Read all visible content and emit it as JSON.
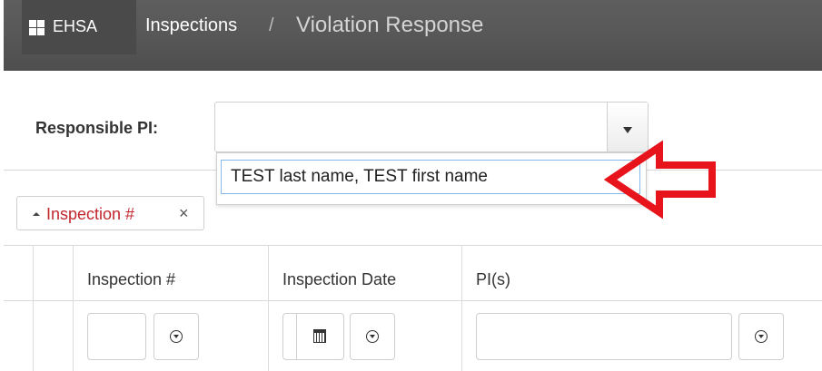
{
  "nav": {
    "brand": "EHSA",
    "breadcrumb_link": "Inspections",
    "breadcrumb_separator": "/",
    "breadcrumb_current": "Violation Response"
  },
  "responsible_pi": {
    "label": "Responsible PI:",
    "value": "",
    "dropdown_options": [
      "TEST last name, TEST first name"
    ]
  },
  "filter_chip": {
    "label": "Inspection #",
    "close": "×"
  },
  "grid": {
    "columns": [
      "Inspection #",
      "Inspection Date",
      "PI(s)"
    ]
  },
  "colors": {
    "navbar": "#585858",
    "chip_text": "#c1272d",
    "arrow": "#e8141b",
    "highlight_border": "#86b8e8"
  },
  "icons": [
    "grid-icon",
    "caret-down-icon",
    "red-arrow-icon",
    "caret-up-icon",
    "close-icon",
    "calendar-icon",
    "filter-icon"
  ]
}
